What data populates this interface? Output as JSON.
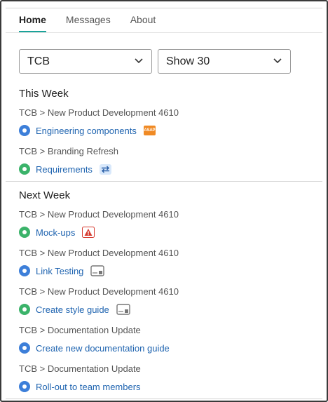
{
  "tabs": [
    {
      "label": "Home",
      "active": true
    },
    {
      "label": "Messages",
      "active": false
    },
    {
      "label": "About",
      "active": false
    }
  ],
  "filters": {
    "company": {
      "value": "TCB"
    },
    "count": {
      "value": "Show 30"
    }
  },
  "colors": {
    "accent_tab_underline": "#1aa39a",
    "link": "#1f64b0",
    "status_blue": "#3d7fd9",
    "status_green": "#3bb36a",
    "asap_badge": "#f08a24",
    "warning_badge": "#d63a2f"
  },
  "sections": [
    {
      "heading": "This Week",
      "tasks": [
        {
          "breadcrumb": "TCB > New Product Development 4610",
          "title": "Engineering components",
          "status": "blue",
          "badge": {
            "icon": "asap-badge-icon",
            "text": "ASAP"
          }
        },
        {
          "breadcrumb": "TCB > Branding Refresh",
          "title": "Requirements",
          "status": "green",
          "badge": {
            "icon": "swap-arrows-icon"
          }
        }
      ]
    },
    {
      "heading": "Next Week",
      "tasks": [
        {
          "breadcrumb": "TCB > New Product Development 4610",
          "title": "Mock-ups",
          "status": "green",
          "badge": {
            "icon": "warning-icon"
          }
        },
        {
          "breadcrumb": "TCB > New Product Development 4610",
          "title": "Link Testing",
          "status": "blue",
          "badge": {
            "icon": "tray-icon"
          }
        },
        {
          "breadcrumb": "TCB > New Product Development 4610",
          "title": "Create style guide",
          "status": "green",
          "badge": {
            "icon": "tray-icon"
          }
        },
        {
          "breadcrumb": "TCB > Documentation Update",
          "title": "Create new documentation guide",
          "status": "blue",
          "badge": null
        },
        {
          "breadcrumb": "TCB > Documentation Update",
          "title": "Roll-out to team members",
          "status": "blue",
          "badge": null
        }
      ]
    }
  ]
}
